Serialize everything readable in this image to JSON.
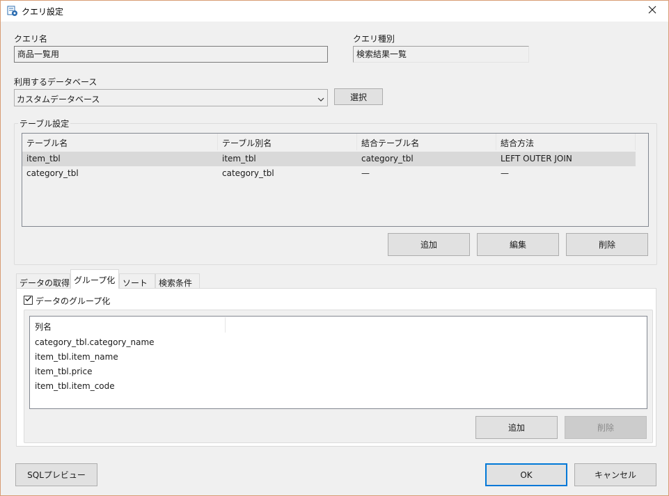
{
  "window": {
    "title": "クエリ設定"
  },
  "query_name": {
    "label": "クエリ名",
    "value": "商品一覧用"
  },
  "query_type": {
    "label": "クエリ種別",
    "value": "検索結果一覧"
  },
  "database": {
    "label": "利用するデータベース",
    "selected": "カスタムデータベース",
    "select_button": "選択"
  },
  "table_settings": {
    "title": "テーブル設定",
    "columns": [
      "テーブル名",
      "テーブル別名",
      "結合テーブル名",
      "結合方法"
    ],
    "rows": [
      [
        "item_tbl",
        "item_tbl",
        "category_tbl",
        "LEFT OUTER JOIN"
      ],
      [
        "category_tbl",
        "category_tbl",
        "—",
        "—"
      ]
    ],
    "add_button": "追加",
    "edit_button": "編集",
    "delete_button": "削除"
  },
  "tabs": [
    "データの取得",
    "グループ化",
    "ソート",
    "検索条件"
  ],
  "grouping": {
    "checkbox_label": "データのグループ化",
    "checked": true,
    "column_header": "列名",
    "items": [
      "category_tbl.category_name",
      "item_tbl.item_name",
      "item_tbl.price",
      "item_tbl.item_code"
    ],
    "add_button": "追加",
    "delete_button": "削除"
  },
  "footer": {
    "sql_preview_button": "SQLプレビュー",
    "ok_button": "OK",
    "cancel_button": "キャンセル"
  }
}
